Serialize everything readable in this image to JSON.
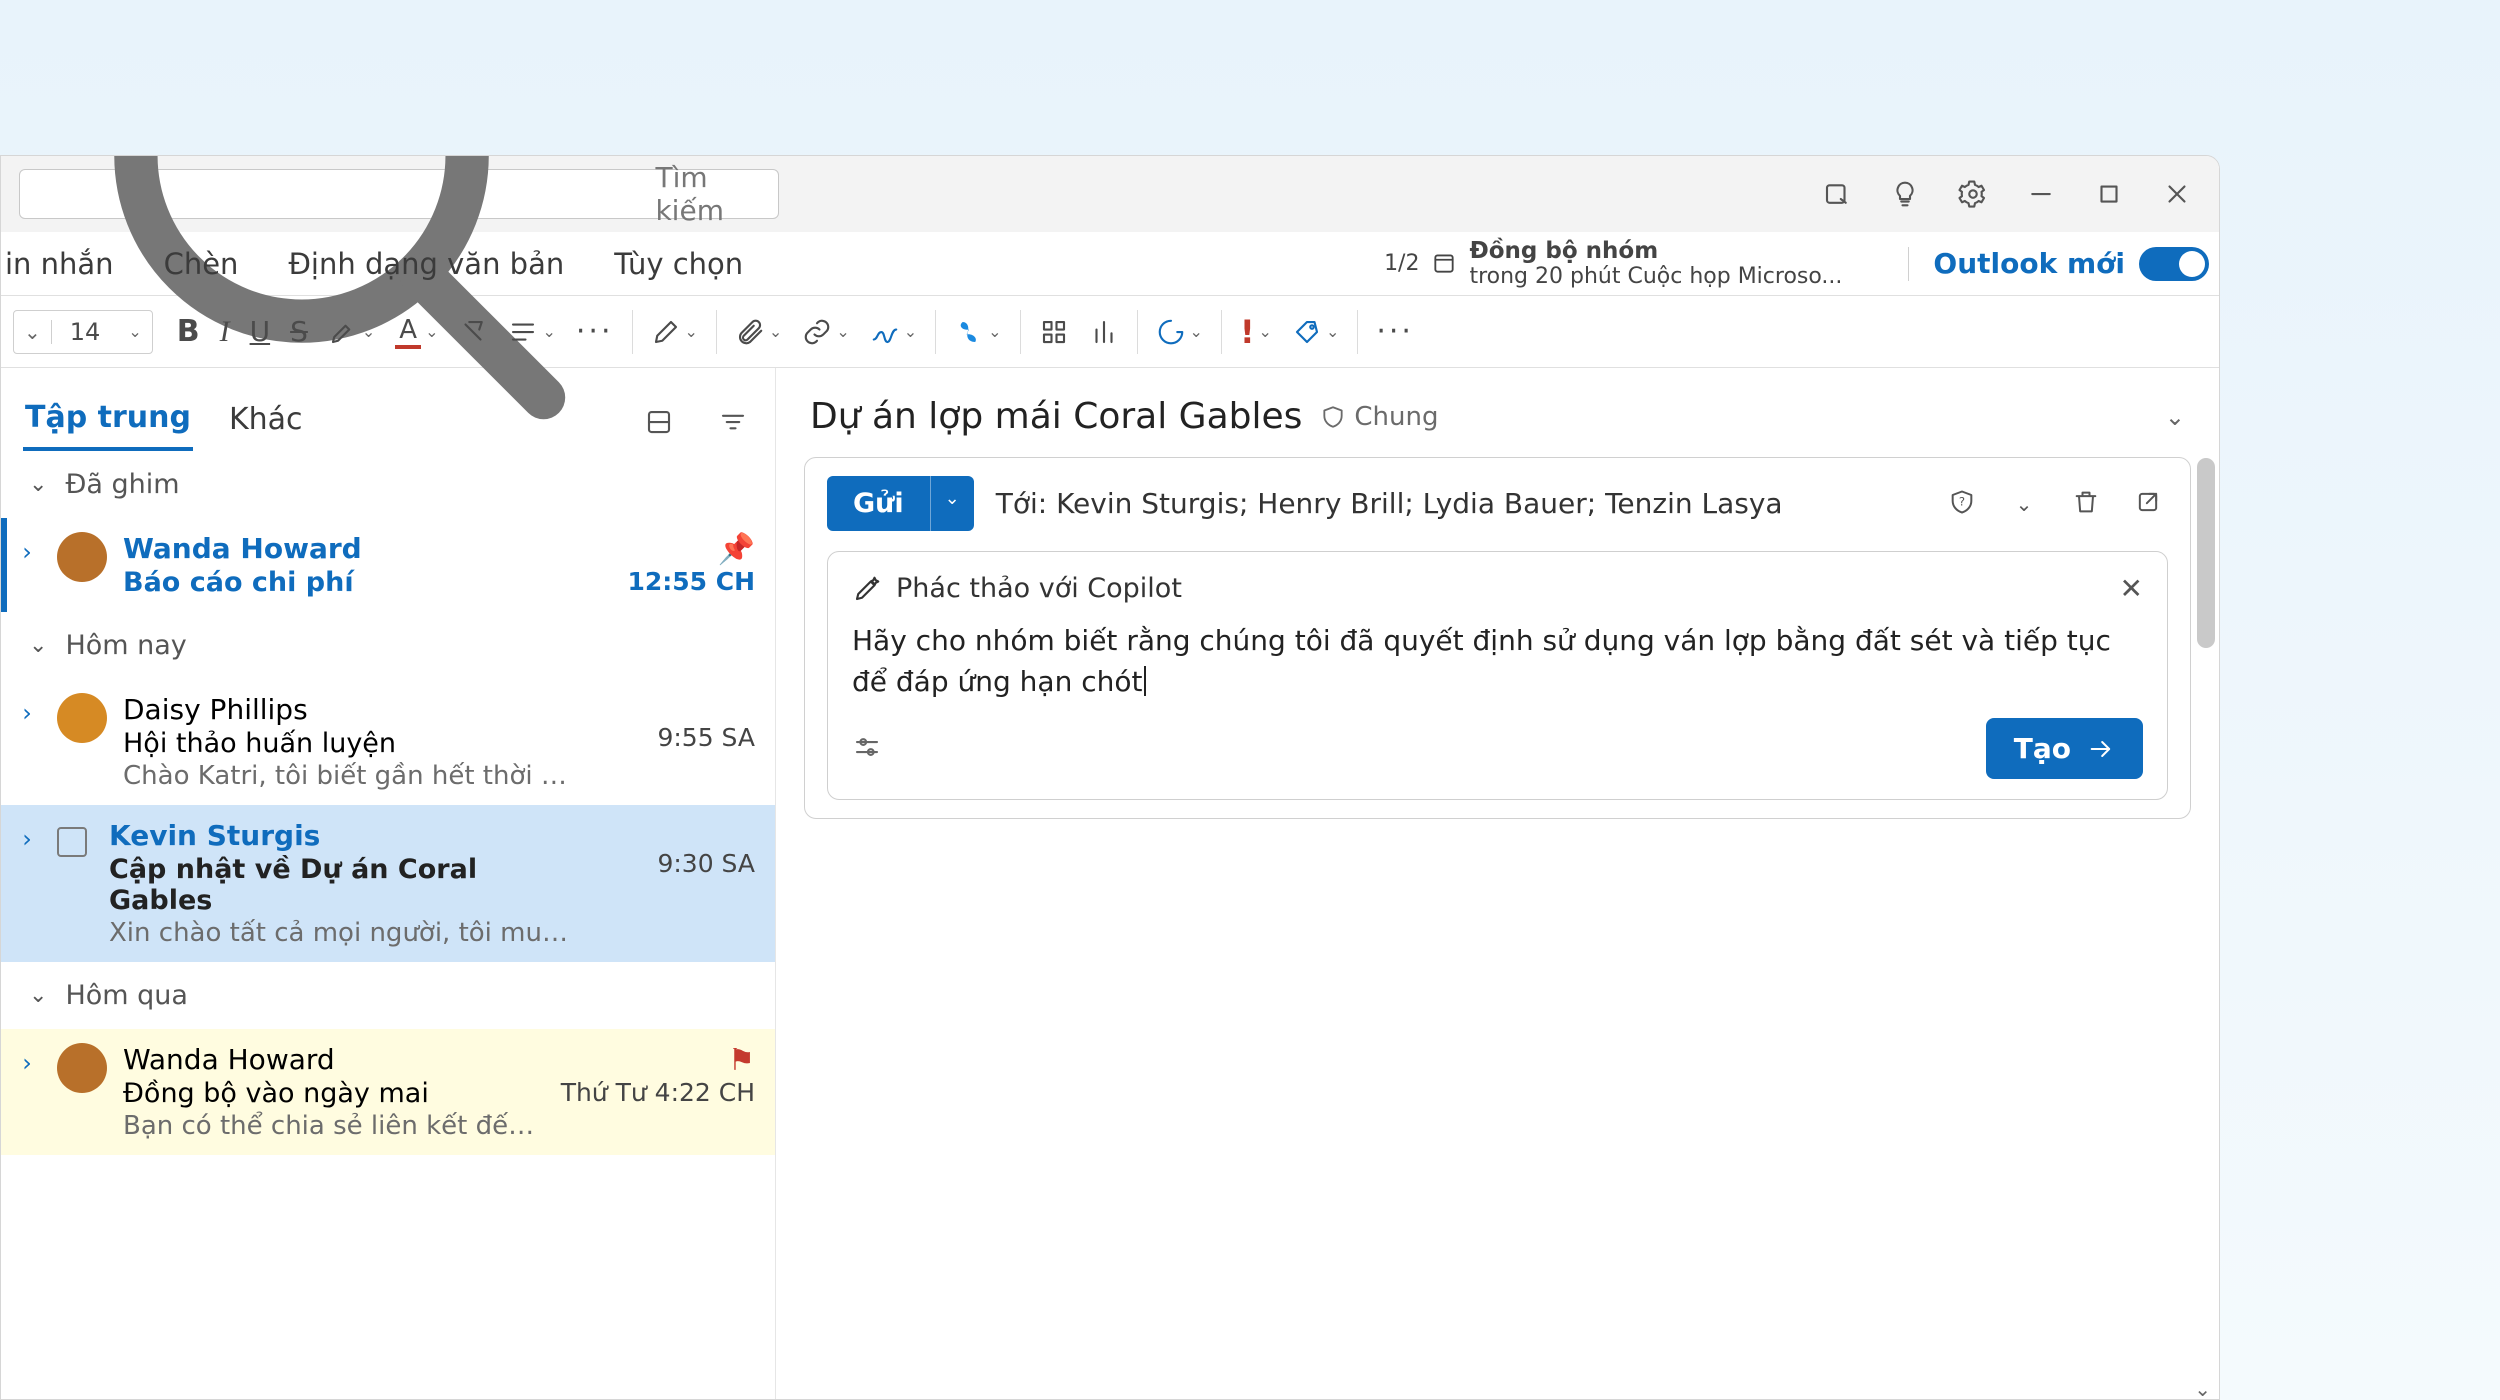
{
  "search": {
    "placeholder": "Tìm kiếm"
  },
  "ribbon_tabs": {
    "t0": "in nhắn",
    "t1": "Chèn",
    "t2": "Định dạng văn bản",
    "t3": "Tùy chọn"
  },
  "sync": {
    "count": "1/2",
    "line1": "Đồng bộ nhóm",
    "line2": "trong 20 phút Cuộc họp Microso..."
  },
  "new_outlook_label": "Outlook mới",
  "fontsize": "14",
  "list_tabs": {
    "focused": "Tập trung",
    "other": "Khác"
  },
  "groups": {
    "pinned": "Đã ghim",
    "today": "Hôm nay",
    "yesterday": "Hôm qua"
  },
  "messages": {
    "m0": {
      "name": "Wanda Howard",
      "subject": "Báo cáo chi phí",
      "time": "12:55 CH"
    },
    "m1": {
      "name": "Daisy Phillips",
      "subject": "Hội thảo huấn luyện",
      "preview": "Chào Katri, tôi biết gần hết thời gian, nh...",
      "time": "9:55 SA"
    },
    "m2": {
      "name": "Kevin Sturgis",
      "subject": "Cập nhật về Dự án Coral Gables",
      "preview": "Xin chào tất cả mọi người, tôi muốn cập...",
      "time": "9:30 SA"
    },
    "m3": {
      "name": "Wanda Howard",
      "subject": "Đồng bộ vào ngày mai",
      "preview": "Bạn có thể chia sẻ liên kết đến bộ phận t...",
      "time": "Thứ Tư 4:22 CH"
    }
  },
  "read": {
    "subject": "Dự án lợp mái Coral Gables",
    "sensitivity": "Chung",
    "send_label": "Gửi",
    "to_label": "Tới:",
    "to_value": "Kevin Sturgis; Henry Brill; Lydia Bauer; Tenzin Lasya"
  },
  "copilot": {
    "header": "Phác thảo với Copilot",
    "text": "Hãy cho nhóm biết rằng chúng tôi đã quyết định sử dụng ván lợp bằng đất sét và tiếp tục để đáp ứng hạn chót",
    "generate": "Tạo"
  }
}
